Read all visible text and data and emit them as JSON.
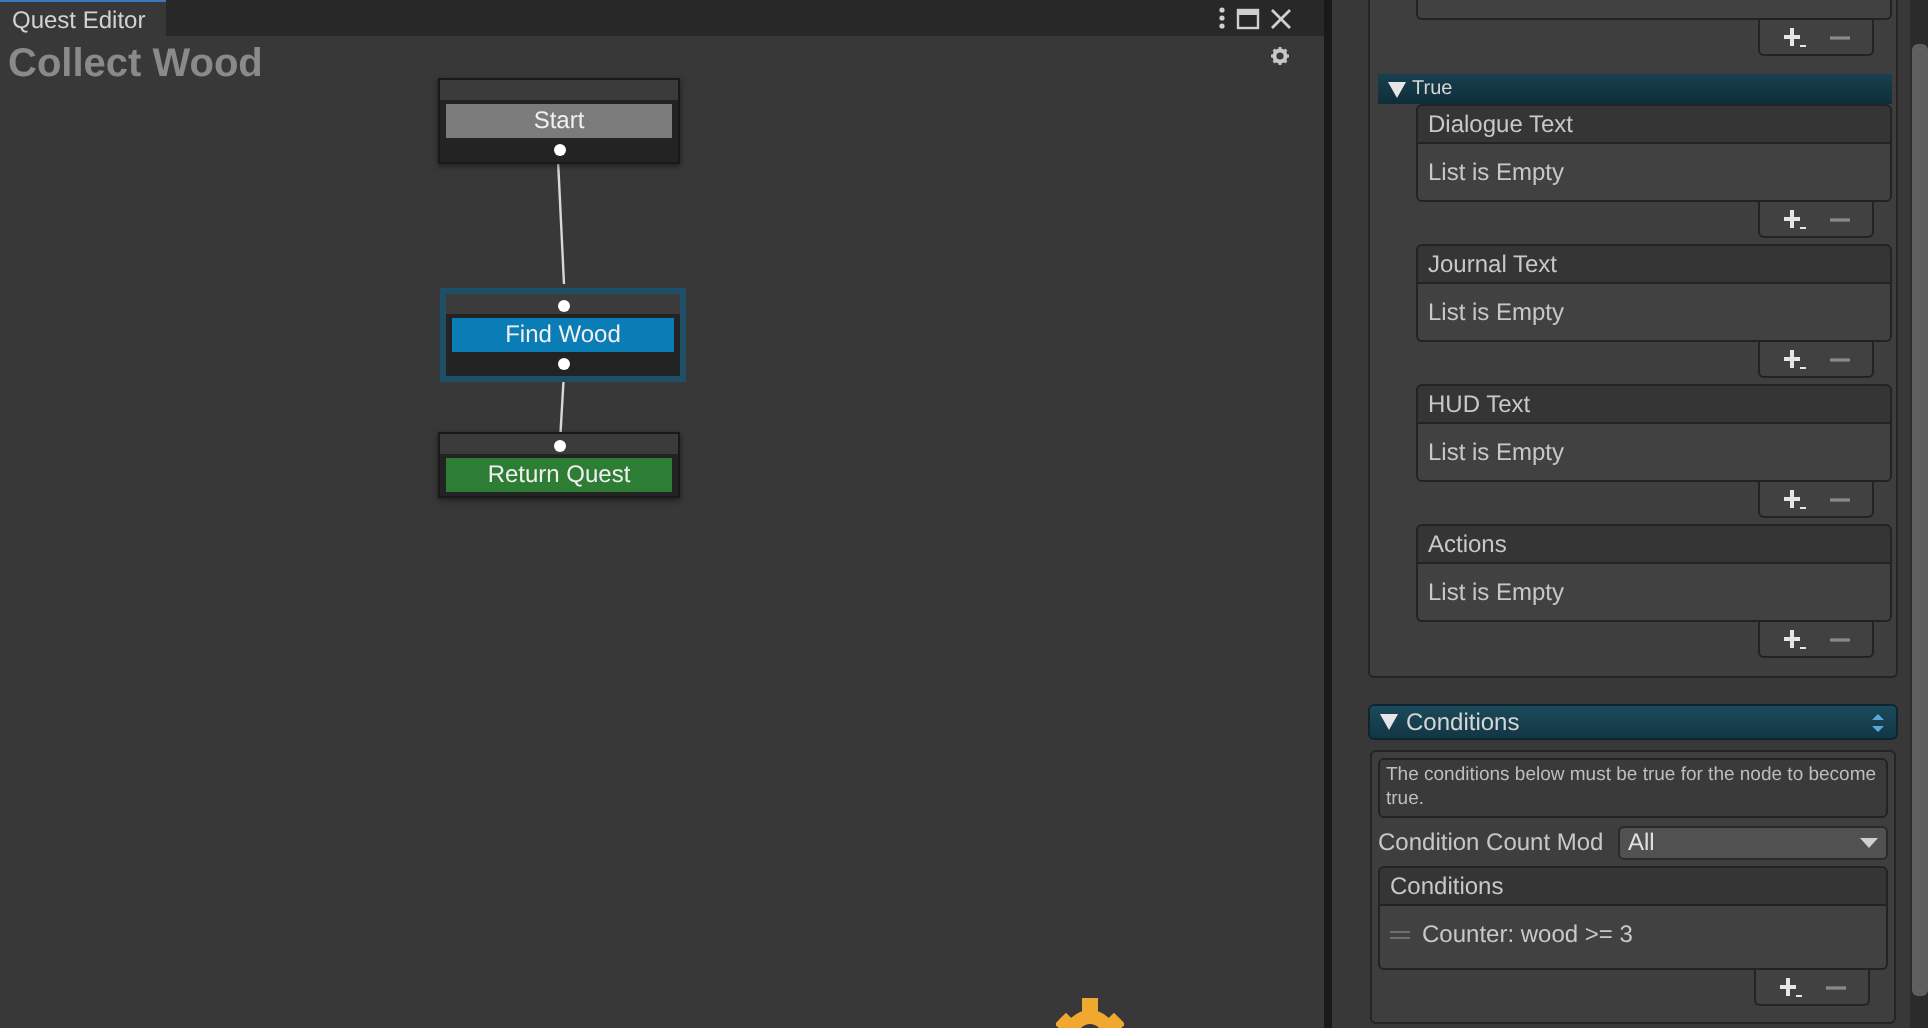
{
  "window": {
    "tab": "Quest Editor"
  },
  "canvas": {
    "title": "Collect Wood",
    "nodes": [
      {
        "label": "Start",
        "kind": "start",
        "selected": false
      },
      {
        "label": "Find Wood",
        "kind": "task",
        "selected": true
      },
      {
        "label": "Return Quest",
        "kind": "end",
        "selected": false
      }
    ]
  },
  "inspector": {
    "true_foldout": {
      "label": "True",
      "expanded": true,
      "lists": [
        {
          "title": "Dialogue Text",
          "empty_text": "List is Empty"
        },
        {
          "title": "Journal Text",
          "empty_text": "List is Empty"
        },
        {
          "title": "HUD Text",
          "empty_text": "List is Empty"
        },
        {
          "title": "Actions",
          "empty_text": "List is Empty"
        }
      ]
    },
    "conditions": {
      "label": "Conditions",
      "expanded": true,
      "help": "The conditions below must be true for the node to become true.",
      "count_mode": {
        "label": "Condition Count Mod",
        "value": "All"
      },
      "list": {
        "title": "Conditions",
        "items": [
          "Counter: wood >= 3"
        ]
      }
    }
  }
}
